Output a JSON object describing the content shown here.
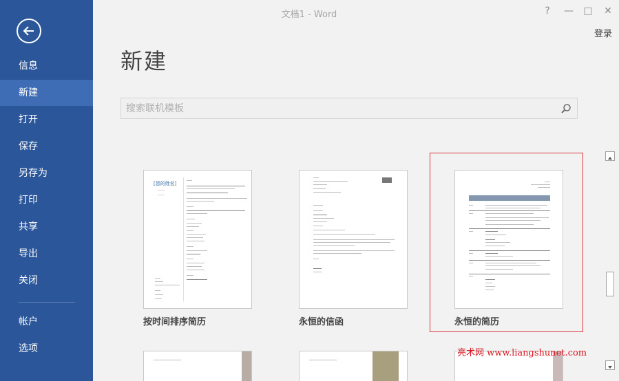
{
  "window": {
    "title": "文档1 - Word",
    "login": "登录",
    "help": "?",
    "minimize": "—",
    "restore": "□",
    "close": "✕"
  },
  "sidebar": {
    "back_icon": "back-arrow-icon",
    "items": [
      {
        "label": "信息",
        "active": false
      },
      {
        "label": "新建",
        "active": true
      },
      {
        "label": "打开",
        "active": false
      },
      {
        "label": "保存",
        "active": false
      },
      {
        "label": "另存为",
        "active": false
      },
      {
        "label": "打印",
        "active": false
      },
      {
        "label": "共享",
        "active": false
      },
      {
        "label": "导出",
        "active": false
      },
      {
        "label": "关闭",
        "active": false
      }
    ],
    "bottom_items": [
      {
        "label": "帐户"
      },
      {
        "label": "选项"
      }
    ]
  },
  "main": {
    "title": "新建",
    "search": {
      "placeholder": "搜索联机模板",
      "icon": "search-icon"
    },
    "templates": [
      {
        "label": "按时间排序简历",
        "thumb_heading": "[您的姓名]"
      },
      {
        "label": "永恒的信函",
        "thumb_heading": ""
      },
      {
        "label": "永恒的简历",
        "thumb_heading": "",
        "selected": true
      }
    ]
  },
  "watermark": "亮术网 www.liangshunet.com",
  "colors": {
    "sidebar": "#2b579a",
    "sidebar_active": "#3e6db5",
    "selection": "#d9323a"
  }
}
